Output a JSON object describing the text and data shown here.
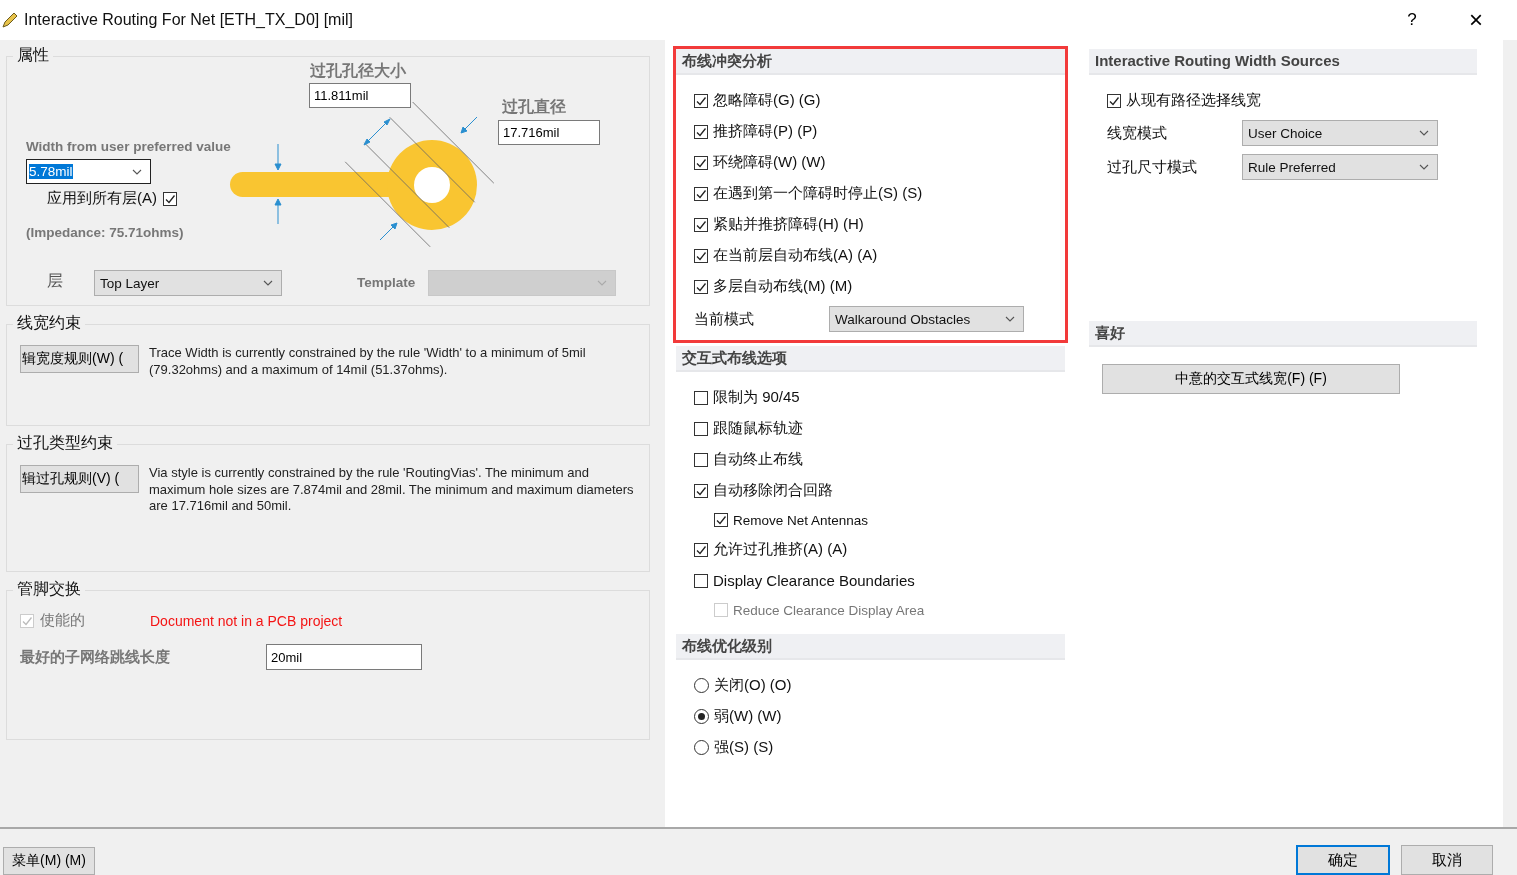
{
  "window": {
    "title": "Interactive Routing For Net [ETH_TX_D0] [mil]",
    "help": "?",
    "close": "×"
  },
  "properties": {
    "title": "属性",
    "width_label": "Width from user preferred value",
    "width_value": "5.78mil",
    "apply_all": {
      "label": "应用到所有层(A)",
      "checked": true
    },
    "impedance": "(Impedance: 75.71ohms)",
    "hole_label": "过孔孔径大小",
    "hole_value": "11.811mil",
    "diameter_label": "过孔直径",
    "diameter_value": "17.716mil",
    "layer_label": "层",
    "layer_value": "Top Layer",
    "template_label": "Template",
    "template_disabled": true
  },
  "width_constraint": {
    "title": "线宽约束",
    "button": "辑宽度规则(W) (",
    "text": "Trace Width is currently constrained by the rule 'Width' to a minimum of 5mil (79.32ohms) and a maximum of 14mil (51.37ohms)."
  },
  "via_constraint": {
    "title": "过孔类型约束",
    "button": "辑过孔规则(V) (",
    "text": "Via style is currently constrained by the rule 'RoutingVias'. The minimum and maximum hole sizes are 7.874mil and 28mil. The minimum and maximum diameters are 17.716mil and 50mil."
  },
  "pin_swap": {
    "title": "管脚交换",
    "enable": {
      "label": "使能的",
      "checked": true,
      "disabled": true
    },
    "note": "Document not in a PCB project",
    "subnet_label": "最好的子网络跳线长度",
    "subnet_value": "20mil"
  },
  "middle_sections": [
    {
      "title": "布线冲突分析",
      "highlighted": true,
      "items": [
        {
          "kind": "checkbox",
          "label": "忽略障碍(G) (G)",
          "checked": true,
          "disabled": false
        },
        {
          "kind": "checkbox",
          "label": "推挤障碍(P) (P)",
          "checked": true,
          "disabled": false
        },
        {
          "kind": "checkbox",
          "label": "环绕障碍(W) (W)",
          "checked": true,
          "disabled": false
        },
        {
          "kind": "checkbox",
          "label": "在遇到第一个障碍时停止(S) (S)",
          "checked": true,
          "disabled": false
        },
        {
          "kind": "checkbox",
          "label": "紧贴并推挤障碍(H) (H)",
          "checked": true,
          "disabled": false
        },
        {
          "kind": "checkbox",
          "label": "在当前层自动布线(A) (A)",
          "checked": true,
          "disabled": false
        },
        {
          "kind": "checkbox",
          "label": "多层自动布线(M) (M)",
          "checked": true,
          "disabled": false
        },
        {
          "kind": "dropdown",
          "label": "当前模式",
          "value": "Walkaround Obstacles"
        }
      ]
    },
    {
      "title": "交互式布线选项",
      "highlighted": false,
      "items": [
        {
          "kind": "checkbox",
          "label": "限制为 90/45",
          "checked": false,
          "disabled": false
        },
        {
          "kind": "checkbox",
          "label": "跟随鼠标轨迹",
          "checked": false,
          "disabled": false
        },
        {
          "kind": "checkbox",
          "label": "自动终止布线",
          "checked": false,
          "disabled": false
        },
        {
          "kind": "checkbox",
          "label": "自动移除闭合回路",
          "checked": true,
          "disabled": false,
          "children": [
            {
              "kind": "checkbox",
              "label": "Remove Net Antennas",
              "checked": true,
              "disabled": false
            }
          ]
        },
        {
          "kind": "checkbox",
          "label": "允许过孔推挤(A) (A)",
          "checked": true,
          "disabled": false
        },
        {
          "kind": "checkbox",
          "label": "Display Clearance Boundaries",
          "checked": false,
          "disabled": false,
          "children": [
            {
              "kind": "checkbox",
              "label": "Reduce Clearance Display Area",
              "checked": false,
              "disabled": true
            }
          ]
        }
      ]
    },
    {
      "title": "布线优化级别",
      "highlighted": false,
      "items": [
        {
          "kind": "radio",
          "label": "关闭(O) (O)",
          "selected": false
        },
        {
          "kind": "radio",
          "label": "弱(W) (W)",
          "selected": true
        },
        {
          "kind": "radio",
          "label": "强(S) (S)",
          "selected": false
        }
      ]
    }
  ],
  "right_sections": [
    {
      "title": "Interactive Routing Width Sources",
      "items": [
        {
          "kind": "checkbox",
          "label": "从现有路径选择线宽",
          "checked": true,
          "disabled": false
        },
        {
          "kind": "dropdown",
          "label": "线宽模式",
          "value": "User Choice"
        },
        {
          "kind": "dropdown",
          "label": "过孔尺寸模式",
          "value": "Rule Preferred"
        }
      ]
    },
    {
      "title": "喜好",
      "items": [
        {
          "kind": "button",
          "label": "中意的交互式线宽(F) (F)"
        }
      ]
    }
  ],
  "footer": {
    "menu": "菜单(M) (M)",
    "ok": "确定",
    "cancel": "取消"
  }
}
